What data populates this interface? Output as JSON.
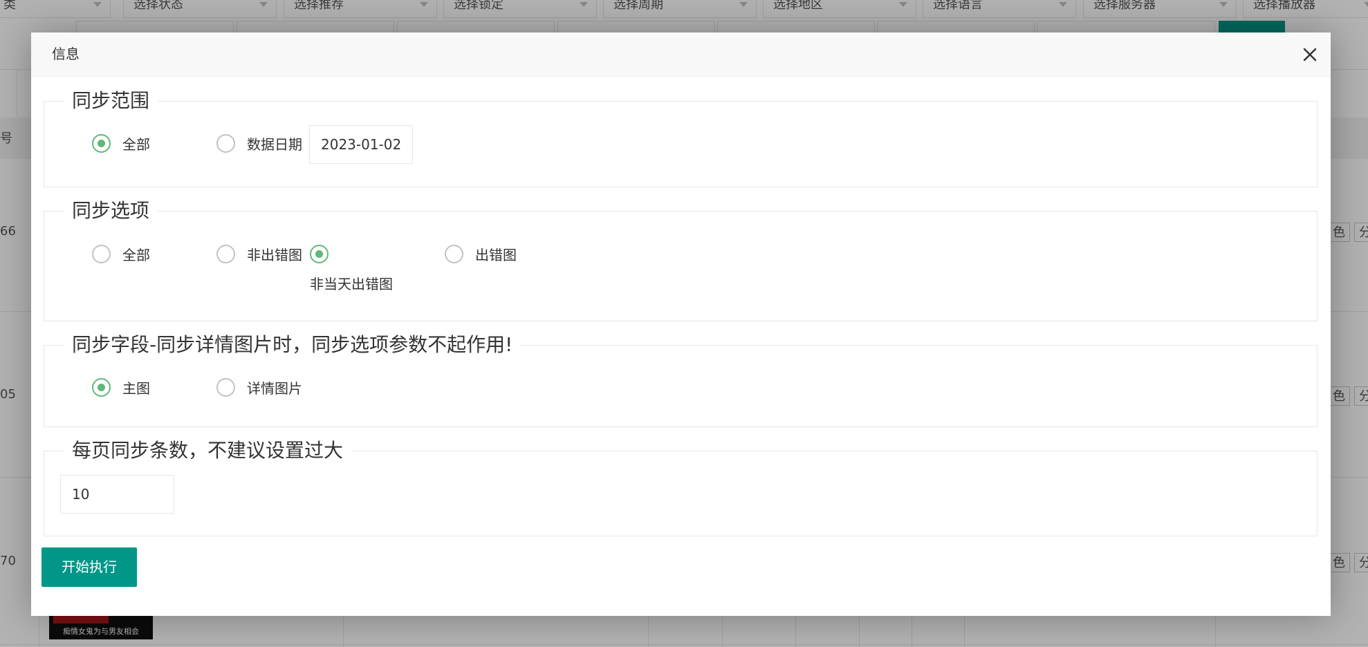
{
  "background": {
    "filters": [
      "类",
      "选择状态",
      "选择推荐",
      "选择锁定",
      "选择周期",
      "选择地区",
      "选择语言",
      "选择服务器",
      "选择播放器"
    ],
    "column_header": "号",
    "row_ids": [
      "66",
      "05",
      "70"
    ],
    "row_action": "色",
    "row_action_2": "分",
    "thumbnail_caption": "痴情女鬼为与男友相会"
  },
  "modal": {
    "title": "信息",
    "sync_range": {
      "legend": "同步范围",
      "options": [
        {
          "label": "全部",
          "checked": true
        },
        {
          "label": "数据日期",
          "checked": false
        }
      ],
      "date_value": "2023-01-02"
    },
    "sync_options": {
      "legend": "同步选项",
      "options": [
        {
          "label": "全部",
          "checked": false
        },
        {
          "label": "非出错图",
          "checked": false
        },
        {
          "label": "非当天出错图",
          "checked": true
        },
        {
          "label": "出错图",
          "checked": false
        }
      ]
    },
    "sync_fields": {
      "legend": "同步字段-同步详情图片时，同步选项参数不起作用!",
      "options": [
        {
          "label": "主图",
          "checked": true
        },
        {
          "label": "详情图片",
          "checked": false
        }
      ]
    },
    "per_page": {
      "legend": "每页同步条数，不建议设置过大",
      "value": "10"
    },
    "submit_label": "开始执行"
  },
  "colors": {
    "accent": "#009688",
    "radio_checked": "#5fb878",
    "border": "#e6e6e6"
  },
  "icons": {
    "close": "close-icon",
    "select_arrow": "caret-down-icon"
  }
}
